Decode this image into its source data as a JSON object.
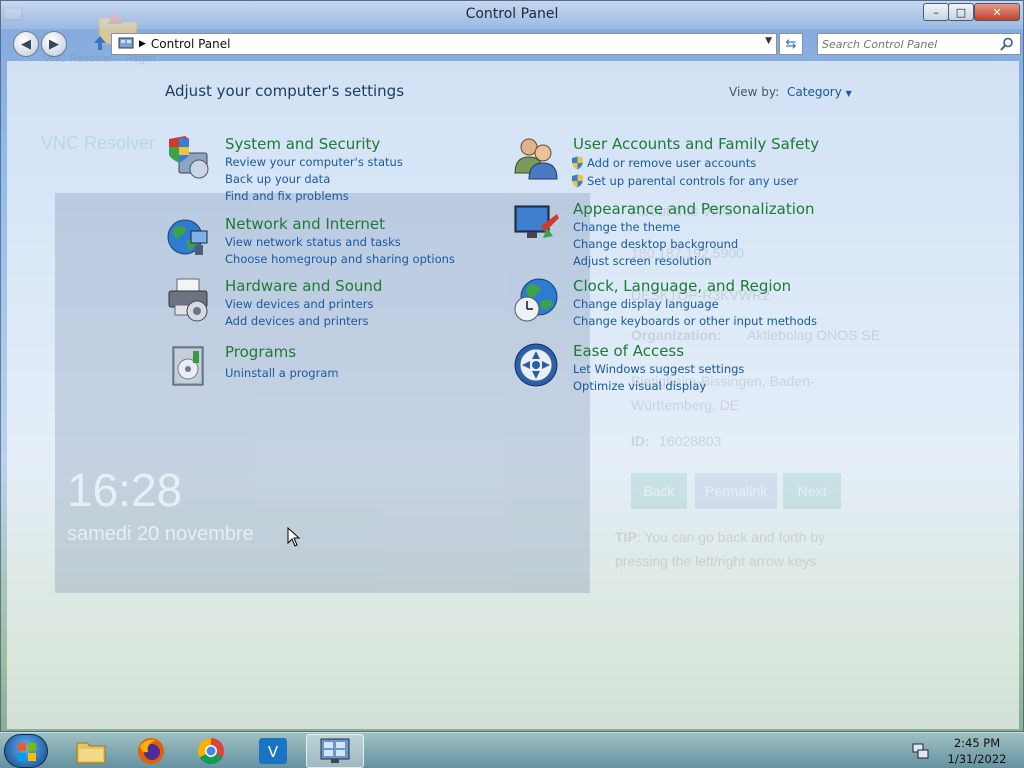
{
  "window": {
    "title": "Control Panel",
    "minimize": "–",
    "maximize": "□",
    "close": "✕"
  },
  "navigation": {
    "back_icon": "arrow-left",
    "forward_icon": "arrow-right",
    "address_path": "Control Panel",
    "search_placeholder": "Search Control Panel"
  },
  "content": {
    "header": "Adjust your computer's settings",
    "view_by_label": "View by:",
    "view_by_value": "Category"
  },
  "categories": [
    {
      "title": "System and Security",
      "icon": "shield-computer-icon",
      "links": [
        "Review your computer's status",
        "Back up your data",
        "Find and fix problems"
      ]
    },
    {
      "title": "Network and Internet",
      "icon": "globe-network-icon",
      "links": [
        "View network status and tasks",
        "Choose homegroup and sharing options"
      ]
    },
    {
      "title": "Hardware and Sound",
      "icon": "printer-speaker-icon",
      "links": [
        "View devices and printers",
        "Add devices and printers"
      ]
    },
    {
      "title": "Programs",
      "icon": "programs-box-icon",
      "links": [
        "Uninstall a program"
      ]
    },
    {
      "title": "User Accounts and Family Safety",
      "icon": "users-icon",
      "links": [
        "Add or remove user accounts",
        "Set up parental controls for any user"
      ]
    },
    {
      "title": "Appearance and Personalization",
      "icon": "monitor-paint-icon",
      "links": [
        "Change the theme",
        "Change desktop background",
        "Adjust screen resolution"
      ]
    },
    {
      "title": "Clock, Language, and Region",
      "icon": "globe-clock-icon",
      "links": [
        "Change display language",
        "Change keyboards or other input methods"
      ]
    },
    {
      "title": "Ease of Access",
      "icon": "ease-of-access-icon",
      "links": [
        "Let Windows suggest settings",
        "Optimize visual display"
      ]
    }
  ],
  "background_ghost": {
    "tab_title": "VNC Resolver – Regist",
    "page_heading": "VNC Resolver",
    "lock_time": "16:28",
    "lock_date": "samedi 20 novembre",
    "about_heading": "About this VNC",
    "address": "180.187.192.5900",
    "hostname": "DESKTOP-R3KVWR2",
    "org_label": "Organization:",
    "org_value": "Aktiebolag ONOS SE",
    "location": "Bietigheim-Bissingen, Baden-Württemberg, DE",
    "id_label": "ID:",
    "id_value": "16028803",
    "btn_back": "Back",
    "btn_permalink": "Permalink",
    "btn_next": "Next",
    "tip_label": "TIP",
    "tip_text": ": You can go back and forth by pressing the left/right arrow keys"
  },
  "taskbar": {
    "apps": [
      {
        "name": "file-explorer-icon",
        "active": false
      },
      {
        "name": "firefox-icon",
        "active": false
      },
      {
        "name": "chrome-icon",
        "active": false
      },
      {
        "name": "vnc-viewer-icon",
        "active": false
      },
      {
        "name": "control-panel-icon",
        "active": true
      }
    ],
    "time": "2:45 PM",
    "date": "1/31/2022"
  },
  "colors": {
    "category_title": "#1f7a34",
    "link": "#1a5aa0",
    "header_text": "#1e3c64"
  }
}
